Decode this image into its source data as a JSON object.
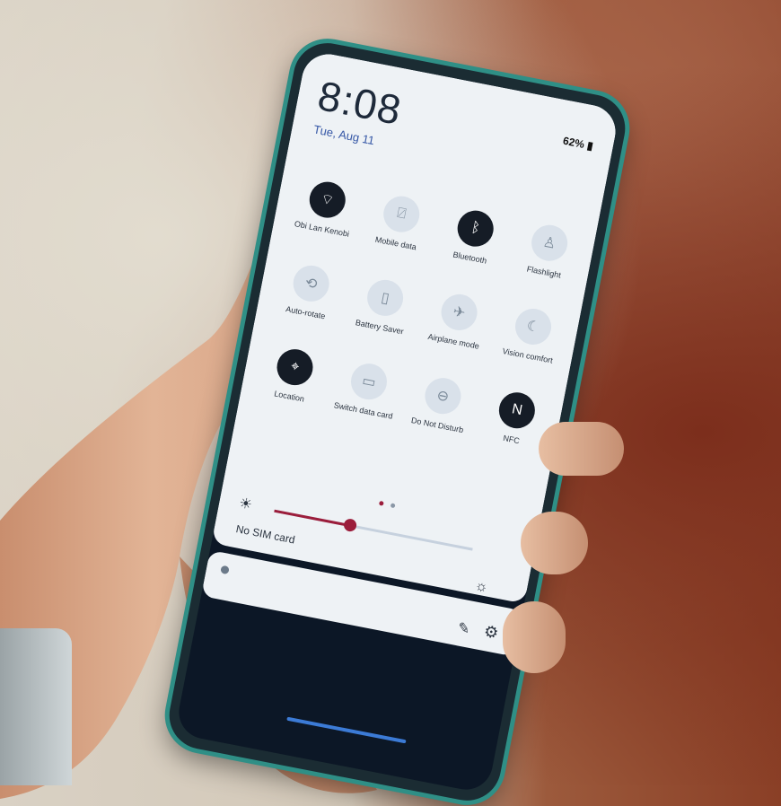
{
  "status": {
    "battery": "62%"
  },
  "clock": {
    "time": "8:08",
    "date": "Tue, Aug 11"
  },
  "tiles": [
    {
      "label": "Obi Lan Kenobi",
      "icon": "wifi-icon",
      "on": true
    },
    {
      "label": "Mobile data",
      "icon": "mobile-data-icon",
      "on": false
    },
    {
      "label": "Bluetooth",
      "icon": "bluetooth-icon",
      "on": true
    },
    {
      "label": "Flashlight",
      "icon": "flashlight-icon",
      "on": false
    },
    {
      "label": "Auto-rotate",
      "icon": "auto-rotate-icon",
      "on": false
    },
    {
      "label": "Battery Saver",
      "icon": "battery-saver-icon",
      "on": false
    },
    {
      "label": "Airplane mode",
      "icon": "airplane-icon",
      "on": false
    },
    {
      "label": "Vision comfort",
      "icon": "moon-icon",
      "on": false
    },
    {
      "label": "Location",
      "icon": "location-pin-icon",
      "on": true
    },
    {
      "label": "Switch data card",
      "icon": "sim-card-icon",
      "on": false
    },
    {
      "label": "Do Not Disturb",
      "icon": "do-not-disturb-icon",
      "on": false
    },
    {
      "label": "NFC",
      "icon": "nfc-icon",
      "on": true
    }
  ],
  "brightness": {
    "level": 0.38
  },
  "sim": {
    "text": "No SIM card"
  },
  "colors": {
    "accent": "#9b1d3b",
    "tile_on": "#151c26",
    "tile_off": "#d9e1ea"
  }
}
